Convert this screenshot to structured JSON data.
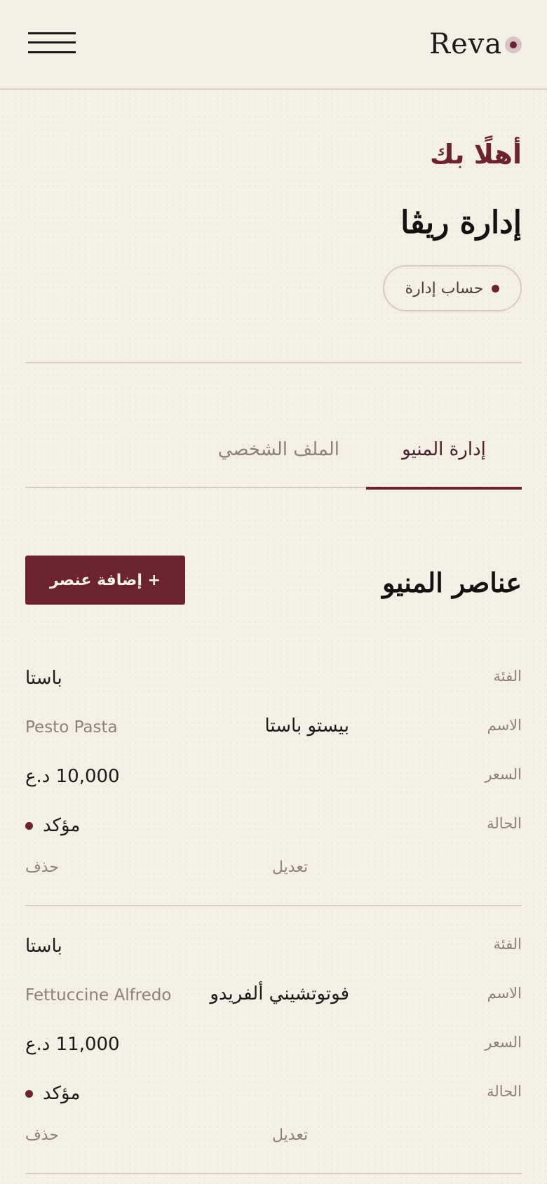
{
  "header": {
    "logo": "Reva"
  },
  "hero": {
    "welcome": "أهلًا بك",
    "title": "إدارة ريڤا",
    "role_badge": "حساب إدارة"
  },
  "tabs": [
    {
      "label": "إدارة المنيو",
      "active": true
    },
    {
      "label": "الملف الشخصي",
      "active": false
    }
  ],
  "section": {
    "title": "عناصر المنيو",
    "add_button": "+ إضافة عنصر"
  },
  "labels": {
    "category": "الفئة",
    "name": "الاسم",
    "price": "السعر",
    "status": "الحالة",
    "edit": "تعديل",
    "delete": "حذف"
  },
  "items": [
    {
      "category": "باستا",
      "name_ar": "بيستو باستا",
      "name_en": "Pesto Pasta",
      "price": "10,000 د.ع",
      "status": "مؤكد"
    },
    {
      "category": "باستا",
      "name_ar": "فوتوتشيني ألفريدو",
      "name_en": "Fettuccine Alfredo",
      "price": "11,000 د.ع",
      "status": "مؤكد"
    }
  ],
  "colors": {
    "background": "#f5f0e6",
    "accent": "#6b2330",
    "muted_text": "#8b8178",
    "divider": "#d6cec2"
  }
}
